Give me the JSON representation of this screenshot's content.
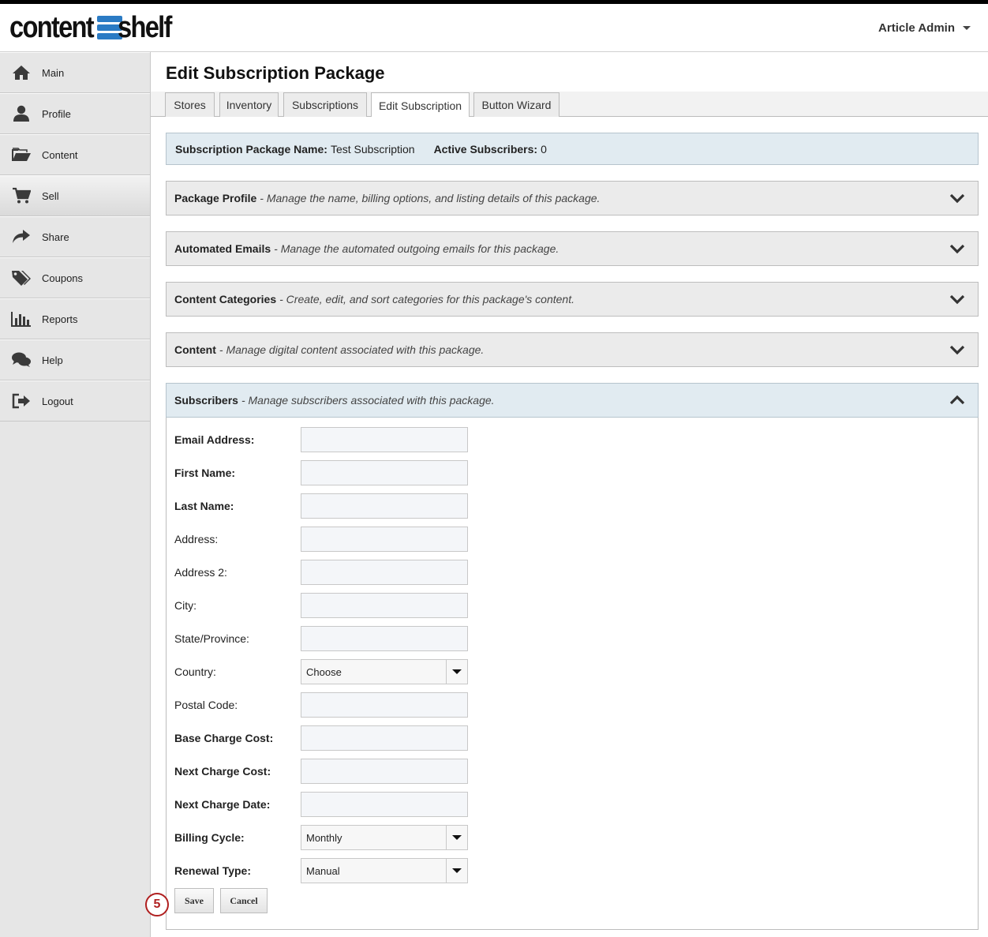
{
  "brand": {
    "logo_left": "content",
    "logo_right": "shelf",
    "accent": "#2b7bc4"
  },
  "header": {
    "user_label": "Article Admin"
  },
  "sidebar": {
    "items": [
      {
        "label": "Main",
        "icon": "home-icon"
      },
      {
        "label": "Profile",
        "icon": "user-icon"
      },
      {
        "label": "Content",
        "icon": "folder-icon"
      },
      {
        "label": "Sell",
        "icon": "cart-icon"
      },
      {
        "label": "Share",
        "icon": "share-icon"
      },
      {
        "label": "Coupons",
        "icon": "tags-icon"
      },
      {
        "label": "Reports",
        "icon": "bar-chart-icon"
      },
      {
        "label": "Help",
        "icon": "chat-icon"
      },
      {
        "label": "Logout",
        "icon": "logout-icon"
      }
    ],
    "active": "Sell"
  },
  "page": {
    "title": "Edit Subscription Package"
  },
  "tabs": [
    {
      "label": "Stores"
    },
    {
      "label": "Inventory"
    },
    {
      "label": "Subscriptions"
    },
    {
      "label": "Edit Subscription"
    },
    {
      "label": "Button Wizard"
    }
  ],
  "active_tab": "Edit Subscription",
  "info": {
    "name_label": "Subscription Package Name:",
    "name_value": "Test Subscription",
    "subs_label": "Active Subscribers:",
    "subs_value": "0"
  },
  "panels": [
    {
      "title": "Package Profile",
      "desc": "- Manage the name, billing options, and listing details of this package."
    },
    {
      "title": "Automated Emails",
      "desc": "- Manage the automated outgoing emails for this package."
    },
    {
      "title": "Content Categories",
      "desc": "- Create, edit, and sort categories for this package's content."
    },
    {
      "title": "Content",
      "desc": "- Manage digital content associated with this package."
    },
    {
      "title": "Subscribers",
      "desc": "- Manage subscribers associated with this package."
    }
  ],
  "form": {
    "email": {
      "label": "Email Address:",
      "value": ""
    },
    "first_name": {
      "label": "First Name:",
      "value": ""
    },
    "last_name": {
      "label": "Last Name:",
      "value": ""
    },
    "address": {
      "label": "Address:",
      "value": ""
    },
    "address2": {
      "label": "Address 2:",
      "value": ""
    },
    "city": {
      "label": "City:",
      "value": ""
    },
    "state": {
      "label": "State/Province:",
      "value": ""
    },
    "country": {
      "label": "Country:",
      "selected": "Choose"
    },
    "postal": {
      "label": "Postal Code:",
      "value": ""
    },
    "base_cost": {
      "label": "Base Charge Cost:",
      "value": ""
    },
    "next_cost": {
      "label": "Next Charge Cost:",
      "value": ""
    },
    "next_date": {
      "label": "Next Charge Date:",
      "value": ""
    },
    "billing_cycle": {
      "label": "Billing Cycle:",
      "selected": "Monthly"
    },
    "renewal_type": {
      "label": "Renewal Type:",
      "selected": "Manual"
    }
  },
  "buttons": {
    "save": "Save",
    "cancel": "Cancel"
  },
  "step_badge": "5"
}
